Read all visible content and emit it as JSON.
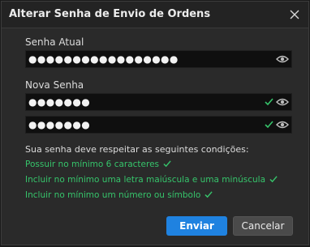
{
  "dialog": {
    "title": "Alterar Senha de Envio de Ordens"
  },
  "fields": {
    "current": {
      "label": "Senha Atual",
      "value": "●●●●●●●●●●●●●●●●●"
    },
    "new": {
      "label": "Nova Senha",
      "value": "●●●●●●●"
    },
    "confirm": {
      "value": "●●●●●●●"
    }
  },
  "rules": {
    "heading": "Sua senha deve respeitar as seguintes condições:",
    "items": [
      "Possuir no mínimo 6 caracteres",
      "Incluir no mínimo uma letra maiúscula e uma minúscula",
      "Incluir no mínimo um número ou símbolo"
    ]
  },
  "buttons": {
    "submit": "Enviar",
    "cancel": "Cancelar"
  },
  "colors": {
    "accent": "#1f82e0",
    "success": "#36c46b"
  },
  "icons": {
    "close": "close-icon",
    "show_password": "eye-icon",
    "valid": "checkmark-icon"
  }
}
